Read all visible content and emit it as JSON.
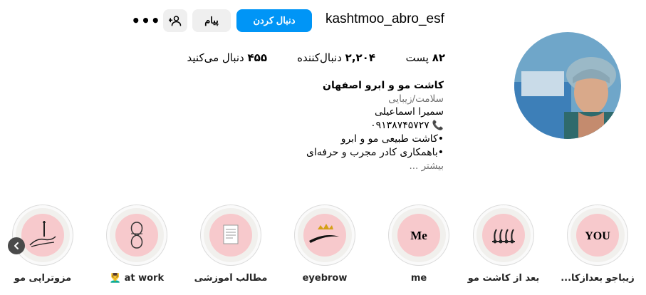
{
  "header": {
    "username": "kashtmoo_abro_esf",
    "follow_label": "دنبال کردن",
    "message_label": "پیام",
    "suggest_icon": "person-add-icon",
    "more_label": "•••"
  },
  "stats": {
    "posts_count": "۸۲",
    "posts_label": "پست",
    "followers_count": "۲,۲۰۴",
    "followers_label": "دنبال‌کننده",
    "following_count": "۴۵۵",
    "following_label": "دنبال می‌کنید"
  },
  "bio": {
    "name": "کاشت مو و ابرو اصفهان",
    "category": "سلامت/زیبایی",
    "line1": "سمیرا اسماعیلی",
    "line2": "۰۹۱۳۸۷۴۵۷۲۷",
    "line3": "•کاشت طبیعی مو و ابرو",
    "line4": "•باهمکاری کادر مجرب و حرفه‌ای",
    "more": "بیشتر ..."
  },
  "highlights": [
    {
      "label": "زیباجو بعدازکا...",
      "icon": "you-text",
      "text": "YOU"
    },
    {
      "label": "بعد از کاشت مو",
      "icon": "hair-follicle-icon"
    },
    {
      "label": "me",
      "icon": "me-text",
      "text": "Me"
    },
    {
      "label": "eyebrow",
      "icon": "eyebrow-crown-icon"
    },
    {
      "label": "مطالب آموزشی",
      "icon": "document-icon"
    },
    {
      "label": "at work 💆‍♂️",
      "icon": "logo-icon"
    },
    {
      "label": "مزوتراپی مو",
      "icon": "syringe-hand-icon"
    }
  ],
  "colors": {
    "accent": "#0095f6",
    "highlight_bg": "#f7c9cc"
  }
}
